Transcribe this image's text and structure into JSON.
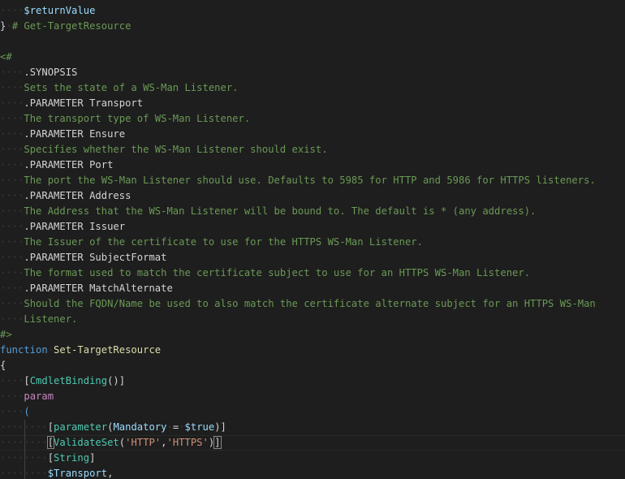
{
  "editor": {
    "colors": {
      "background": "#1e1e1e",
      "comment": "#6a9955",
      "default": "#d4d4d4",
      "variable": "#9cdcfe",
      "keyword": "#c586c0",
      "storage": "#569cd6",
      "function": "#dcdcaa",
      "type": "#4ec9b0",
      "string": "#ce9178"
    },
    "lines": [
      {
        "indent": 1,
        "tokens": [
          {
            "t": "$returnValue",
            "k": "variable"
          }
        ]
      },
      {
        "indent": 0,
        "tokens": [
          {
            "t": "}",
            "k": "default"
          },
          {
            "t": " ",
            "k": "ws"
          },
          {
            "t": "# Get-TargetResource",
            "k": "comment"
          }
        ]
      },
      {
        "indent": 0,
        "tokens": []
      },
      {
        "indent": 0,
        "tokens": [
          {
            "t": "<#",
            "k": "comment"
          }
        ]
      },
      {
        "indent": 1,
        "tokens": [
          {
            "t": ".SYNOPSIS",
            "k": "default"
          }
        ]
      },
      {
        "indent": 1,
        "tokens": [
          {
            "t": "Sets the state of a WS-Man Listener.",
            "k": "comment"
          }
        ]
      },
      {
        "indent": 1,
        "tokens": [
          {
            "t": ".PARAMETER Transport",
            "k": "default"
          }
        ]
      },
      {
        "indent": 1,
        "tokens": [
          {
            "t": "The transport type of WS-Man Listener.",
            "k": "comment"
          }
        ]
      },
      {
        "indent": 1,
        "tokens": [
          {
            "t": ".PARAMETER Ensure",
            "k": "default"
          }
        ]
      },
      {
        "indent": 1,
        "tokens": [
          {
            "t": "Specifies whether the WS-Man Listener should exist.",
            "k": "comment"
          }
        ]
      },
      {
        "indent": 1,
        "tokens": [
          {
            "t": ".PARAMETER Port",
            "k": "default"
          }
        ]
      },
      {
        "indent": 1,
        "tokens": [
          {
            "t": "The port the WS-Man Listener should use. Defaults to 5985 for HTTP and 5986 for HTTPS listeners.",
            "k": "comment"
          }
        ]
      },
      {
        "indent": 1,
        "tokens": [
          {
            "t": ".PARAMETER Address",
            "k": "default"
          }
        ]
      },
      {
        "indent": 1,
        "tokens": [
          {
            "t": "The Address that the WS-Man Listener will be bound to. The default is * (any address).",
            "k": "comment"
          }
        ]
      },
      {
        "indent": 1,
        "tokens": [
          {
            "t": ".PARAMETER Issuer",
            "k": "default"
          }
        ]
      },
      {
        "indent": 1,
        "tokens": [
          {
            "t": "The Issuer of the certificate to use for the HTTPS WS-Man Listener.",
            "k": "comment"
          }
        ]
      },
      {
        "indent": 1,
        "tokens": [
          {
            "t": ".PARAMETER SubjectFormat",
            "k": "default"
          }
        ]
      },
      {
        "indent": 1,
        "tokens": [
          {
            "t": "The format used to match the certificate subject to use for an HTTPS WS-Man Listener.",
            "k": "comment"
          }
        ]
      },
      {
        "indent": 1,
        "tokens": [
          {
            "t": ".PARAMETER MatchAlternate",
            "k": "default"
          }
        ]
      },
      {
        "indent": 1,
        "tokens": [
          {
            "t": "Should the FQDN/Name be used to also match the certificate alternate subject for an HTTPS WS-Man",
            "k": "comment"
          }
        ]
      },
      {
        "indent": 1,
        "tokens": [
          {
            "t": "Listener.",
            "k": "comment"
          }
        ]
      },
      {
        "indent": 0,
        "tokens": [
          {
            "t": "#>",
            "k": "comment"
          }
        ]
      },
      {
        "indent": 0,
        "tokens": [
          {
            "t": "function",
            "k": "storage"
          },
          {
            "t": " ",
            "k": "ws"
          },
          {
            "t": "Set-TargetResource",
            "k": "function"
          }
        ]
      },
      {
        "indent": 0,
        "tokens": [
          {
            "t": "{",
            "k": "default"
          }
        ]
      },
      {
        "indent": 1,
        "tokens": [
          {
            "t": "[",
            "k": "default"
          },
          {
            "t": "CmdletBinding",
            "k": "type"
          },
          {
            "t": "()",
            "k": "default"
          },
          {
            "t": "]",
            "k": "default"
          }
        ]
      },
      {
        "indent": 1,
        "tokens": [
          {
            "t": "param",
            "k": "keyword"
          }
        ]
      },
      {
        "indent": 1,
        "tokens": [
          {
            "t": "(",
            "k": "storage"
          }
        ]
      },
      {
        "indent": 2,
        "tokens": [
          {
            "t": "[",
            "k": "default"
          },
          {
            "t": "parameter",
            "k": "type"
          },
          {
            "t": "(",
            "k": "default"
          },
          {
            "t": "Mandatory",
            "k": "variable"
          },
          {
            "t": " ",
            "k": "ws"
          },
          {
            "t": "=",
            "k": "operator"
          },
          {
            "t": " ",
            "k": "ws"
          },
          {
            "t": "$true",
            "k": "variable"
          },
          {
            "t": ")]",
            "k": "default"
          }
        ]
      },
      {
        "indent": 2,
        "current": true,
        "tokens": [
          {
            "t": "[",
            "k": "bracket-match"
          },
          {
            "t": "ValidateSet",
            "k": "type"
          },
          {
            "t": "(",
            "k": "default"
          },
          {
            "t": "'HTTP'",
            "k": "string"
          },
          {
            "t": ",",
            "k": "default"
          },
          {
            "t": "'HTTPS'",
            "k": "string"
          },
          {
            "t": ")",
            "k": "default"
          },
          {
            "t": "]",
            "k": "bracket-match"
          },
          {
            "t": "",
            "k": "cursor"
          }
        ]
      },
      {
        "indent": 2,
        "tokens": [
          {
            "t": "[",
            "k": "default"
          },
          {
            "t": "String",
            "k": "type"
          },
          {
            "t": "]",
            "k": "default"
          }
        ]
      },
      {
        "indent": 2,
        "tokens": [
          {
            "t": "$Transport",
            "k": "variable"
          },
          {
            "t": ",",
            "k": "default"
          }
        ]
      }
    ]
  }
}
